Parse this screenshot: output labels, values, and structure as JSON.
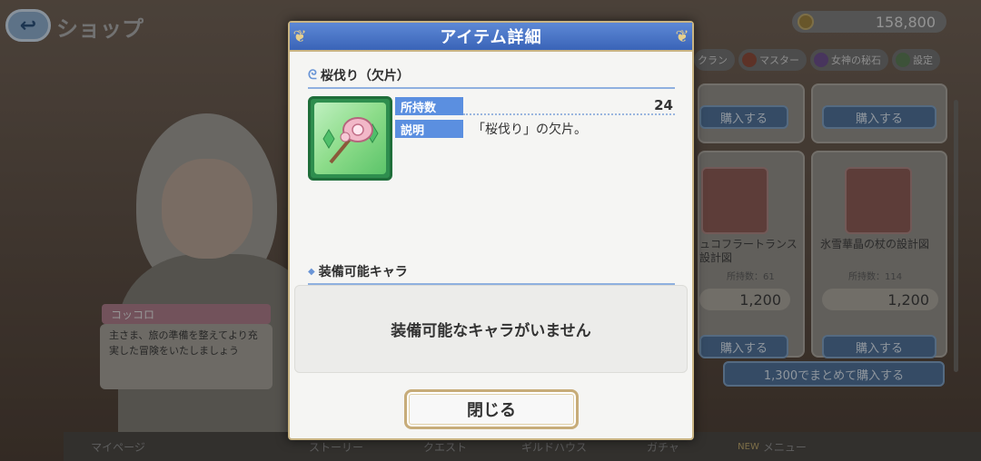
{
  "background": {
    "shop_title": "ショップ",
    "money": "158,800",
    "tabs": [
      "クラン",
      "マスター",
      "女神の秘石",
      "設定"
    ],
    "buy_label": "購入する",
    "items": [
      {
        "name": "ュコフラートランス設計図",
        "count": "所持数：61",
        "price": "1,200"
      },
      {
        "name": "氷雪華晶の杖の設計図",
        "count": "所持数：114",
        "price": "1,200"
      }
    ],
    "bulk_buy": "1,300でまとめて購入する",
    "character": {
      "name": "コッコロ",
      "speech": "主さま、旅の準備を整えてより充実した冒険をいたしましょう"
    },
    "nav": [
      "マイページ",
      "",
      "ストーリー",
      "クエスト",
      "ギルドハウス",
      "ガチャ",
      "メニュー"
    ],
    "nav_new": "NEW"
  },
  "modal": {
    "title": "アイテム詳細",
    "item_name": "桜伐り（欠片）",
    "count_label": "所持数",
    "count_value": "24",
    "desc_label": "説明",
    "desc_value": "「桜伐り」の欠片。",
    "equip_header": "装備可能キャラ",
    "equip_empty": "装備可能なキャラがいません",
    "close_label": "閉じる"
  },
  "colors": {
    "header_blue": "#3a64b8",
    "label_blue": "#5b8fe0",
    "gold_border": "#c9b483"
  }
}
